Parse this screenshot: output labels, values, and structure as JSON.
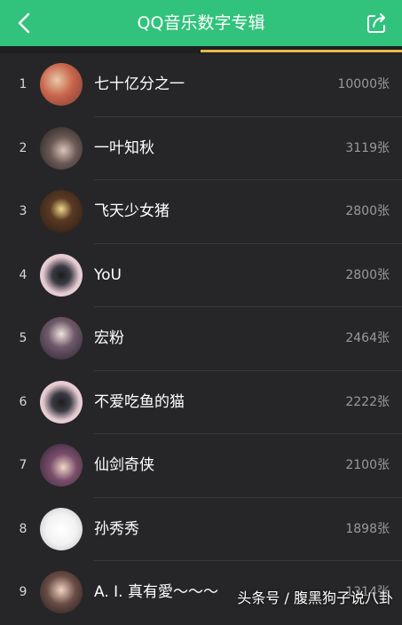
{
  "header": {
    "title": "QQ音乐数字专辑",
    "back_icon": "chevron-left-icon",
    "share_icon": "share-icon"
  },
  "colors": {
    "header_bg": "#31c27c",
    "tab_indicator": "#e8b84a"
  },
  "list": [
    {
      "rank": "1",
      "name": "七十亿分之一",
      "count": "10000张"
    },
    {
      "rank": "2",
      "name": "一叶知秋",
      "count": "3119张"
    },
    {
      "rank": "3",
      "name": "飞天少女猪",
      "count": "2800张"
    },
    {
      "rank": "4",
      "name": "YoU",
      "count": "2800张"
    },
    {
      "rank": "5",
      "name": "宏粉",
      "count": "2464张"
    },
    {
      "rank": "6",
      "name": "不爱吃鱼的猫",
      "count": "2222张"
    },
    {
      "rank": "7",
      "name": "仙剑奇侠",
      "count": "2100张"
    },
    {
      "rank": "8",
      "name": "孙秀秀",
      "count": "1898张"
    },
    {
      "rank": "9",
      "name": "A. I. 真有愛～～～",
      "count": "1314张"
    }
  ],
  "watermark": "头条号 / 腹黑狗子说八卦"
}
